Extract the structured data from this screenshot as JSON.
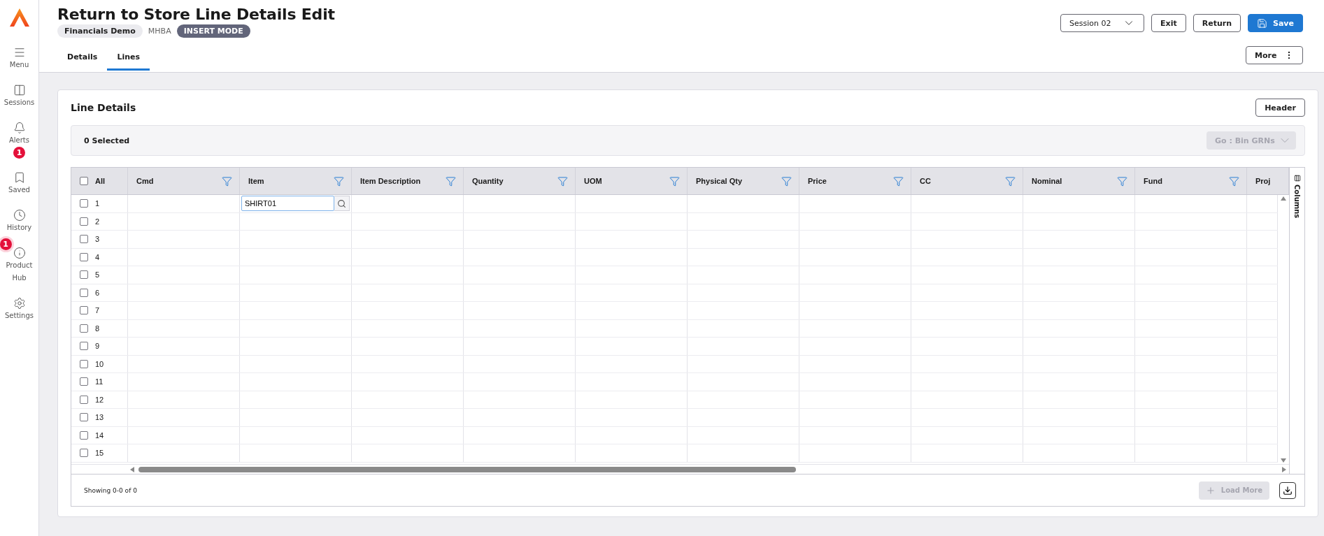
{
  "sidebar": {
    "items": [
      {
        "kind": "menu",
        "label": "Menu"
      },
      {
        "kind": "sessions",
        "label": "Sessions"
      },
      {
        "kind": "alerts",
        "label": "Alerts",
        "badge": "1"
      },
      {
        "kind": "saved",
        "label": "Saved"
      },
      {
        "kind": "history",
        "label": "History"
      },
      {
        "kind": "hub",
        "label": "Product Hub",
        "edge_badge": "1"
      },
      {
        "kind": "settings",
        "label": "Settings"
      }
    ]
  },
  "header": {
    "title": "Return to Store Line Details Edit",
    "company": "Financials Demo",
    "code": "MHBA",
    "mode": "INSERT MODE",
    "session": "Session 02",
    "buttons": [
      {
        "kind": "plain",
        "label": "Exit"
      },
      {
        "kind": "plain",
        "label": "Return"
      },
      {
        "kind": "primary",
        "label": "Save"
      }
    ],
    "more": "More"
  },
  "tabs": [
    {
      "label": "Details",
      "selected": false
    },
    {
      "label": "Lines",
      "selected": true
    }
  ],
  "panel": {
    "title": "Line Details",
    "header_button": "Header",
    "selected_count": "0 Selected",
    "action": {
      "label": "Go : Bin GRNs",
      "disabled": true
    }
  },
  "table": {
    "select_all": {
      "label": "All",
      "checked": false
    },
    "columns": [
      "Cmd",
      "Item",
      "Item Description",
      "Quantity",
      "UOM",
      "Physical Qty",
      "Price",
      "CC",
      "Nominal",
      "Fund",
      "Proj"
    ],
    "rows": [
      {
        "label": "1",
        "checked": false,
        "item": "SHIRT01"
      },
      {
        "label": "2",
        "checked": false
      },
      {
        "label": "3",
        "checked": false
      },
      {
        "label": "4",
        "checked": false
      },
      {
        "label": "5",
        "checked": false
      },
      {
        "label": "6",
        "checked": false
      },
      {
        "label": "7",
        "checked": false
      },
      {
        "label": "8",
        "checked": false
      },
      {
        "label": "9",
        "checked": false
      },
      {
        "label": "10",
        "checked": false
      },
      {
        "label": "11",
        "checked": false
      },
      {
        "label": "12",
        "checked": false
      },
      {
        "label": "13",
        "checked": false
      },
      {
        "label": "14",
        "checked": false
      },
      {
        "label": "15",
        "checked": false
      }
    ],
    "columns_tab": "Columns",
    "status": "Showing 0-0 of 0",
    "load_more": {
      "label": "Load More",
      "disabled": true
    }
  }
}
